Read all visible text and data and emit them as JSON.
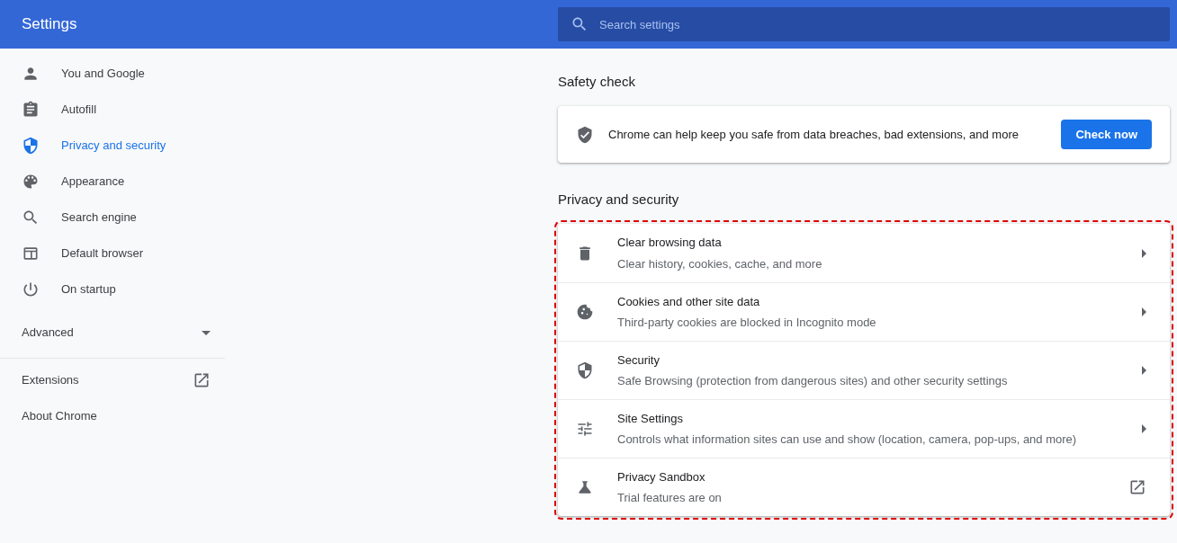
{
  "header": {
    "title": "Settings",
    "search": {
      "placeholder": "Search settings"
    }
  },
  "sidebar": {
    "items": [
      {
        "label": "You and Google",
        "selected": false
      },
      {
        "label": "Autofill",
        "selected": false
      },
      {
        "label": "Privacy and security",
        "selected": true
      },
      {
        "label": "Appearance",
        "selected": false
      },
      {
        "label": "Search engine",
        "selected": false
      },
      {
        "label": "Default browser",
        "selected": false
      },
      {
        "label": "On startup",
        "selected": false
      }
    ],
    "advanced": {
      "label": "Advanced",
      "expanded": false
    },
    "links": [
      {
        "label": "Extensions",
        "external": true
      },
      {
        "label": "About Chrome",
        "external": false
      }
    ]
  },
  "safety_check": {
    "heading": "Safety check",
    "text": "Chrome can help keep you safe from data breaches, bad extensions, and more",
    "button": "Check now"
  },
  "privacy": {
    "heading": "Privacy and security",
    "highlighted": true,
    "rows": [
      {
        "title": "Clear browsing data",
        "subtitle": "Clear history, cookies, cache, and more",
        "kind": "arrow"
      },
      {
        "title": "Cookies and other site data",
        "subtitle": "Third-party cookies are blocked in Incognito mode",
        "kind": "arrow"
      },
      {
        "title": "Security",
        "subtitle": "Safe Browsing (protection from dangerous sites) and other security settings",
        "kind": "arrow"
      },
      {
        "title": "Site Settings",
        "subtitle": "Controls what information sites can use and show (location, camera, pop-ups, and more)",
        "kind": "arrow"
      },
      {
        "title": "Privacy Sandbox",
        "subtitle": "Trial features are on",
        "kind": "external"
      }
    ]
  }
}
